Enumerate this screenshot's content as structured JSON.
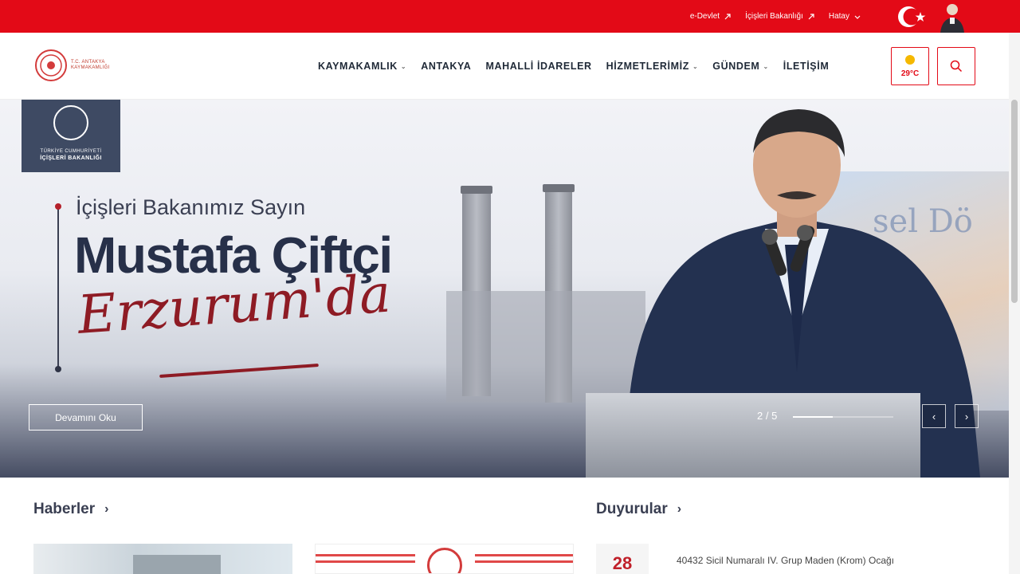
{
  "topbar": {
    "links": [
      {
        "label": "e-Devlet",
        "icon": "external-arrow-icon"
      },
      {
        "label": "İçişleri Bakanlığı",
        "icon": "external-arrow-icon"
      },
      {
        "label": "Hatay",
        "icon": "chevron-down-icon"
      }
    ]
  },
  "header": {
    "logo_line1": "T.C. ANTAKYA",
    "logo_line2": "KAYMAKAMLIĞI",
    "nav": [
      {
        "label": "KAYMAKAMLIK",
        "dropdown": true
      },
      {
        "label": "ANTAKYA",
        "dropdown": false
      },
      {
        "label": "MAHALLİ İDARELER",
        "dropdown": false
      },
      {
        "label": "HİZMETLERİMİZ",
        "dropdown": true
      },
      {
        "label": "GÜNDEM",
        "dropdown": true
      },
      {
        "label": "İLETİŞİM",
        "dropdown": false
      }
    ],
    "weather": {
      "temp": "29°C",
      "icon": "sun-icon"
    }
  },
  "hero": {
    "badge_line1": "TÜRKİYE CUMHURİYETİ",
    "badge_line2": "İÇİŞLERİ BAKANLIĞI",
    "subtitle": "İçişleri Bakanımız Sayın",
    "title": "Mustafa Çiftçi",
    "script": "Erzurum'da",
    "background_text": "sel Dö",
    "more_label": "Devamını Oku",
    "counter": "2 / 5",
    "progress": 0.4
  },
  "news": {
    "title": "Haberler"
  },
  "announcements": {
    "title": "Duyurular",
    "items": [
      {
        "day": "28",
        "text": "40432 Sicil Numaralı IV. Grup Maden (Krom) Ocağı"
      }
    ]
  },
  "colors": {
    "brand_red": "#e30a17",
    "navy": "#273049",
    "dark_red": "#8e1b24"
  }
}
